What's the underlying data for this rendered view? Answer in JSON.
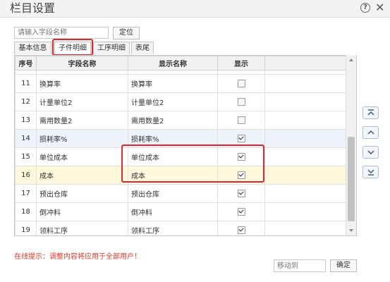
{
  "window": {
    "title": "栏目设置"
  },
  "search": {
    "placeholder": "请输入字段名称",
    "locate_label": "定位"
  },
  "tabs": [
    "基本信息",
    "子件明细",
    "工序明细",
    "表尾"
  ],
  "table": {
    "headers": {
      "seq": "序号",
      "field": "字段名称",
      "display": "显示名称",
      "show": "显示"
    },
    "rows": [
      {
        "seq": "11",
        "field": "换算率",
        "display": "换算率",
        "show": false
      },
      {
        "seq": "12",
        "field": "计量单位2",
        "display": "计量单位2",
        "show": false
      },
      {
        "seq": "13",
        "field": "需用数量2",
        "display": "需用数量2",
        "show": false
      },
      {
        "seq": "14",
        "field": "损耗率%",
        "display": "损耗率%",
        "show": true
      },
      {
        "seq": "15",
        "field": "单位成本",
        "display": "单位成本",
        "show": true
      },
      {
        "seq": "16",
        "field": "成本",
        "display": "成本",
        "show": true
      },
      {
        "seq": "17",
        "field": "预出仓库",
        "display": "预出仓库",
        "show": true
      },
      {
        "seq": "18",
        "field": "倒冲料",
        "display": "倒冲料",
        "show": true
      },
      {
        "seq": "19",
        "field": "领料工序",
        "display": "领料工序",
        "show": true
      }
    ]
  },
  "footer": {
    "notice": "在线提示：调整内容将应用于全部用户！",
    "moveto_placeholder": "移动到",
    "ok_label": "确定"
  }
}
